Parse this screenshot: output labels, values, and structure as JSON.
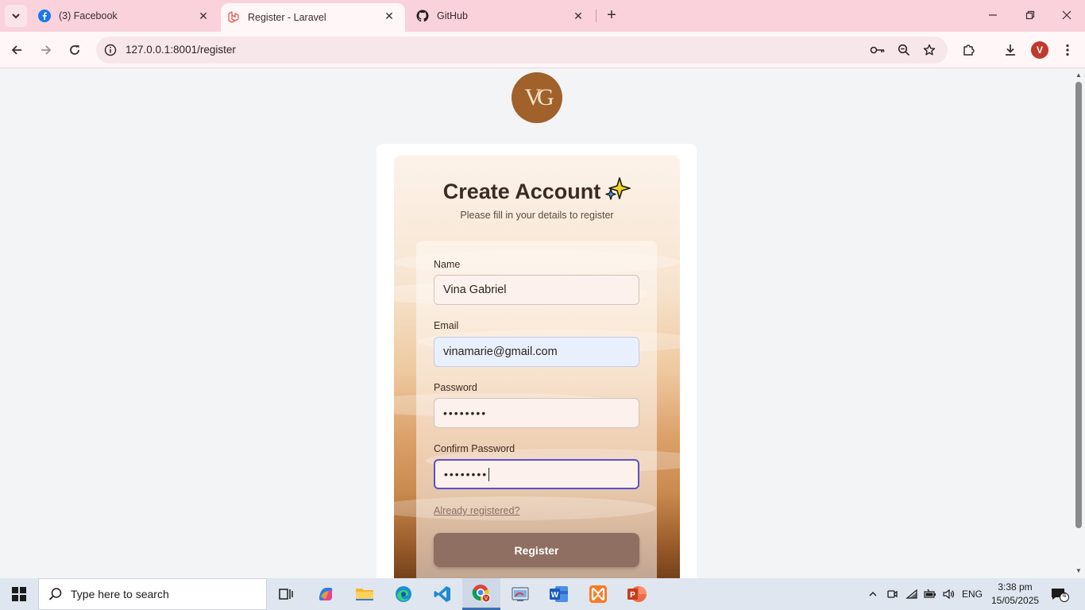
{
  "browser": {
    "tabs": [
      {
        "label": "(3) Facebook",
        "icon": "facebook-icon"
      },
      {
        "label": "Register - Laravel",
        "icon": "laravel-icon",
        "active": true
      },
      {
        "label": "GitHub",
        "icon": "github-icon"
      }
    ],
    "url": "127.0.0.1:8001/register",
    "profile_initial": "V"
  },
  "page": {
    "logo_text": "VG",
    "title": "Create Account",
    "subtitle": "Please fill in your details to register",
    "form": {
      "name_label": "Name",
      "name_value": "Vina Gabriel",
      "email_label": "Email",
      "email_value": "vinamarie@gmail.com",
      "password_label": "Password",
      "password_value": "••••••••",
      "confirm_label": "Confirm Password",
      "confirm_value": "••••••••",
      "login_link": "Already registered?",
      "submit_label": "Register"
    }
  },
  "taskbar": {
    "search_placeholder": "Type here to search",
    "language": "ENG",
    "time": "3:38 pm",
    "date": "15/05/2025",
    "notification_count": "4"
  },
  "colors": {
    "accent": "#8e6f62",
    "logo": "#a0612b",
    "focus_ring": "#5b4fcf"
  }
}
